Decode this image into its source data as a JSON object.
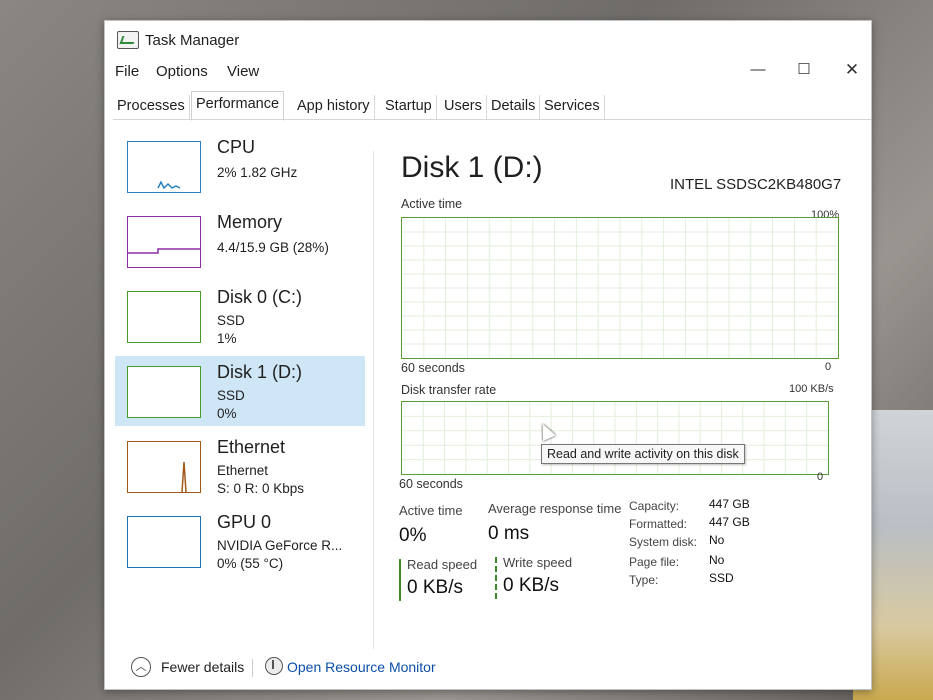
{
  "window": {
    "title": "Task Manager"
  },
  "controls": {
    "minimize": "—",
    "maximize": "☐",
    "close": "✕"
  },
  "menu": [
    "File",
    "Options",
    "View"
  ],
  "tabs": [
    "Processes",
    "Performance",
    "App history",
    "Startup",
    "Users",
    "Details",
    "Services"
  ],
  "active_tab": "Performance",
  "sidebar": [
    {
      "title": "CPU",
      "lines": [
        "2% 1.82 GHz"
      ]
    },
    {
      "title": "Memory",
      "lines": [
        "4.4/15.9 GB (28%)"
      ]
    },
    {
      "title": "Disk 0 (C:)",
      "lines": [
        "SSD",
        "1%"
      ]
    },
    {
      "title": "Disk 1 (D:)",
      "lines": [
        "SSD",
        "0%"
      ],
      "selected": true
    },
    {
      "title": "Ethernet",
      "lines": [
        "Ethernet",
        "S: 0 R: 0 Kbps"
      ]
    },
    {
      "title": "GPU 0",
      "lines": [
        "NVIDIA GeForce R...",
        "0% (55 °C)"
      ]
    }
  ],
  "detail": {
    "title": "Disk 1 (D:)",
    "model": "INTEL SSDSC2KB480G7",
    "graph1": {
      "label": "Active time",
      "max": "100%",
      "time": "60 seconds",
      "min": "0"
    },
    "graph2": {
      "label": "Disk transfer rate",
      "max": "100 KB/s",
      "time": "60 seconds",
      "min": "0"
    },
    "tooltip": "Read and write activity on this disk",
    "stats": {
      "active_time_label": "Active time",
      "active_time": "0%",
      "resp_label": "Average response time",
      "resp": "0 ms",
      "read_label": "Read speed",
      "read": "0 KB/s",
      "write_label": "Write speed",
      "write": "0 KB/s"
    },
    "props": [
      {
        "k": "Capacity:",
        "v": "447 GB"
      },
      {
        "k": "Formatted:",
        "v": "447 GB"
      },
      {
        "k": "System disk:",
        "v": "No"
      },
      {
        "k": "Page file:",
        "v": "No"
      },
      {
        "k": "Type:",
        "v": "SSD"
      }
    ]
  },
  "footer": {
    "fewer": "Fewer details",
    "resmon": "Open Resource Monitor"
  },
  "colors": {
    "disk": "#4a9a2c",
    "cpu": "#2a7fc0",
    "memory": "#8b2fa6",
    "ethernet": "#a25a1c",
    "selected": "#cfe6f6"
  }
}
